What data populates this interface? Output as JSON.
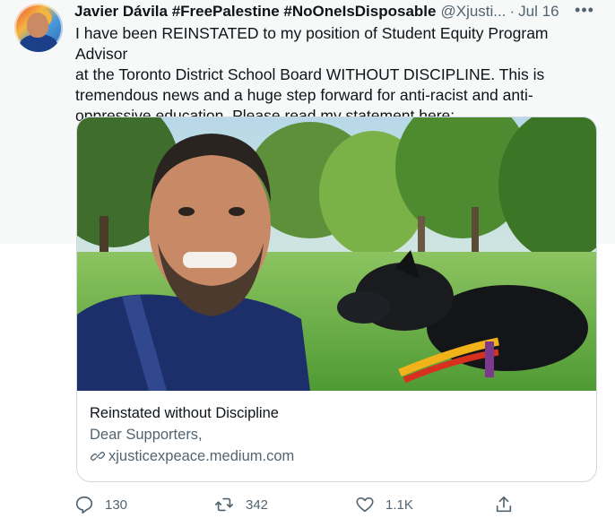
{
  "tweet": {
    "author_name": "Javier Dávila #FreePalestine #NoOneIsDisposable",
    "handle": "@Xjusti...",
    "separator": "·",
    "date": "Jul 16",
    "more_label": "•••",
    "text": "I have been REINSTATED to my position of Student Equity Program Advisor\nat the Toronto District School Board WITHOUT DISCIPLINE. This is\ntremendous news and a huge step forward for anti-racist and anti-\noppressive education. Please read my statement here:"
  },
  "card": {
    "image_icon": "photo-selfie-with-dog",
    "title": "Reinstated without Discipline",
    "description": "Dear Supporters,",
    "link_icon": "link-icon",
    "domain": "xjusticexpeace.medium.com"
  },
  "actions": {
    "reply_count": "130",
    "retweet_count": "342",
    "like_count": "1.1K",
    "share_icon": "share-icon"
  },
  "colors": {
    "text_primary": "#0f1419",
    "text_secondary": "#536471",
    "border": "#cfd9de"
  }
}
